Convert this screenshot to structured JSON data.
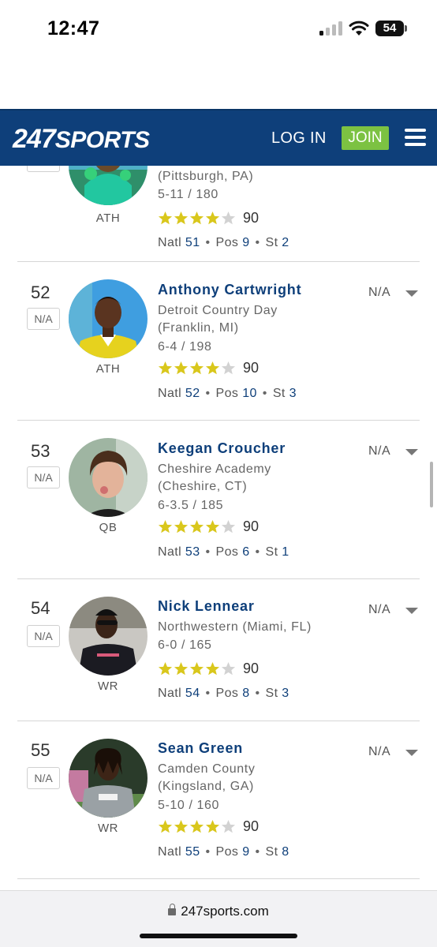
{
  "status_bar": {
    "time": "12:47",
    "battery": "54"
  },
  "header": {
    "logo_number": "247",
    "logo_text": "SPORTS",
    "login_label": "LOG IN",
    "join_label": "JOIN"
  },
  "partial_row": {
    "location": "(Pittsburgh, PA)",
    "measurements": "5-11 / 180",
    "position": "ATH",
    "rating": "90",
    "stars": 4,
    "natl": "51",
    "pos_rank": "9",
    "st_rank": "2",
    "na_label": "N/A"
  },
  "labels": {
    "natl": "Natl",
    "pos": "Pos",
    "st": "St",
    "na": "N/A",
    "dot": "•"
  },
  "players": [
    {
      "rank": "52",
      "name": "Anthony Cartwright",
      "school": "Detroit Country Day",
      "location": "(Franklin, MI)",
      "measurements": "6-4 / 198",
      "position": "ATH",
      "rating": "90",
      "stars": 4,
      "natl": "52",
      "pos_rank": "10",
      "st_rank": "3"
    },
    {
      "rank": "53",
      "name": "Keegan Croucher",
      "school": "Cheshire Academy",
      "location": "(Cheshire, CT)",
      "measurements": "6-3.5 / 185",
      "position": "QB",
      "rating": "90",
      "stars": 4,
      "natl": "53",
      "pos_rank": "6",
      "st_rank": "1"
    },
    {
      "rank": "54",
      "name": "Nick Lennear",
      "school": "Northwestern (Miami, FL)",
      "location": "",
      "measurements": "6-0 / 165",
      "position": "WR",
      "rating": "90",
      "stars": 4,
      "natl": "54",
      "pos_rank": "8",
      "st_rank": "3"
    },
    {
      "rank": "55",
      "name": "Sean Green",
      "school": "Camden County",
      "location": "(Kingsland, GA)",
      "measurements": "5-10 / 160",
      "position": "WR",
      "rating": "90",
      "stars": 4,
      "natl": "55",
      "pos_rank": "9",
      "st_rank": "8"
    }
  ],
  "browser": {
    "url": "247sports.com"
  },
  "colors": {
    "brand_blue": "#0e3f7a",
    "join_green": "#7cc242",
    "star_gold": "#d9c71c",
    "star_empty": "#d2d2d2"
  }
}
